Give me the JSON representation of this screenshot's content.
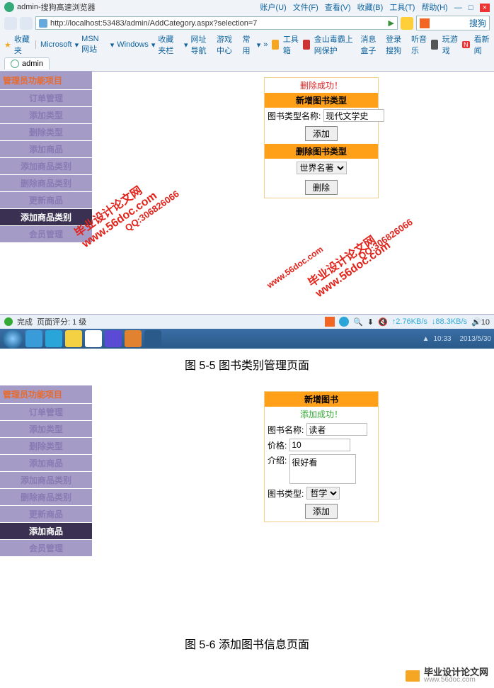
{
  "browser": {
    "title_page": "admin",
    "title_app": "搜狗高速浏览器",
    "top_links": [
      "账户(U)",
      "文件(F)",
      "查看(V)",
      "收藏(B)",
      "工具(T)",
      "帮助(H)"
    ],
    "url": "http://localhost:53483/admin/AddCategory.aspx?selection=7",
    "sogou_btn": "搜狗",
    "bookmarks": {
      "label": "收藏夹",
      "items": [
        "Microsoft",
        "MSN 网站",
        "Windows",
        "收藏夹栏",
        "网址导航",
        "游戏中心",
        "常用"
      ]
    },
    "tools": [
      "工具箱",
      "金山毒霸上网保护",
      "消息盒子",
      "登录搜狗",
      "听音乐",
      "玩游戏",
      "看新闻"
    ],
    "tab": "admin",
    "status_left": "完成",
    "status_jump": "页面评分: 1 级",
    "net_up": "2.76KB/s",
    "net_down": "88.3KB/s",
    "sound": "10",
    "time": "10:33",
    "date": "2013/5/30"
  },
  "page1": {
    "sidebar": {
      "header": "管理员功能项目",
      "items": [
        "订单管理",
        "添加类型",
        "删除类型",
        "添加商品",
        "添加商品类别",
        "删除商品类别",
        "更新商品",
        "添加商品类别",
        "会员管理"
      ],
      "active_index": 7
    },
    "panel": {
      "msg_del": "删除成功！",
      "head_add": "新增图书类型",
      "label_name": "图书类型名称:",
      "val_name": "现代文学史",
      "btn_add": "添加",
      "head_del": "删除图书类型",
      "select_val": "世界名著",
      "btn_del": "删除"
    }
  },
  "caption1": "图 5-5   图书类别管理页面",
  "page2": {
    "sidebar": {
      "header": "管理员功能项目",
      "items": [
        "订单管理",
        "添加类型",
        "删除类型",
        "添加商品",
        "添加商品类别",
        "删除商品类别",
        "更新商品",
        "添加商品",
        "会员管理"
      ],
      "active_index": 7
    },
    "panel": {
      "head": "新增图书",
      "msg_add": "添加成功！",
      "label_name": "图书名称:",
      "val_name": "读者",
      "label_price": "价格:",
      "val_price": "10",
      "label_intro": "介绍:",
      "val_intro": "很好看",
      "label_type": "图书类型:",
      "val_type": "哲学",
      "btn_add": "添加"
    }
  },
  "caption2": "图 5-6   添加图书信息页面",
  "watermarks": {
    "a": "毕业设计论文网\nwww.56doc.com",
    "b": "QQ:306826066",
    "c": "www.56doc.com"
  },
  "footer": {
    "t1": "毕业设计论文网",
    "t2": "www.56doc.com"
  }
}
